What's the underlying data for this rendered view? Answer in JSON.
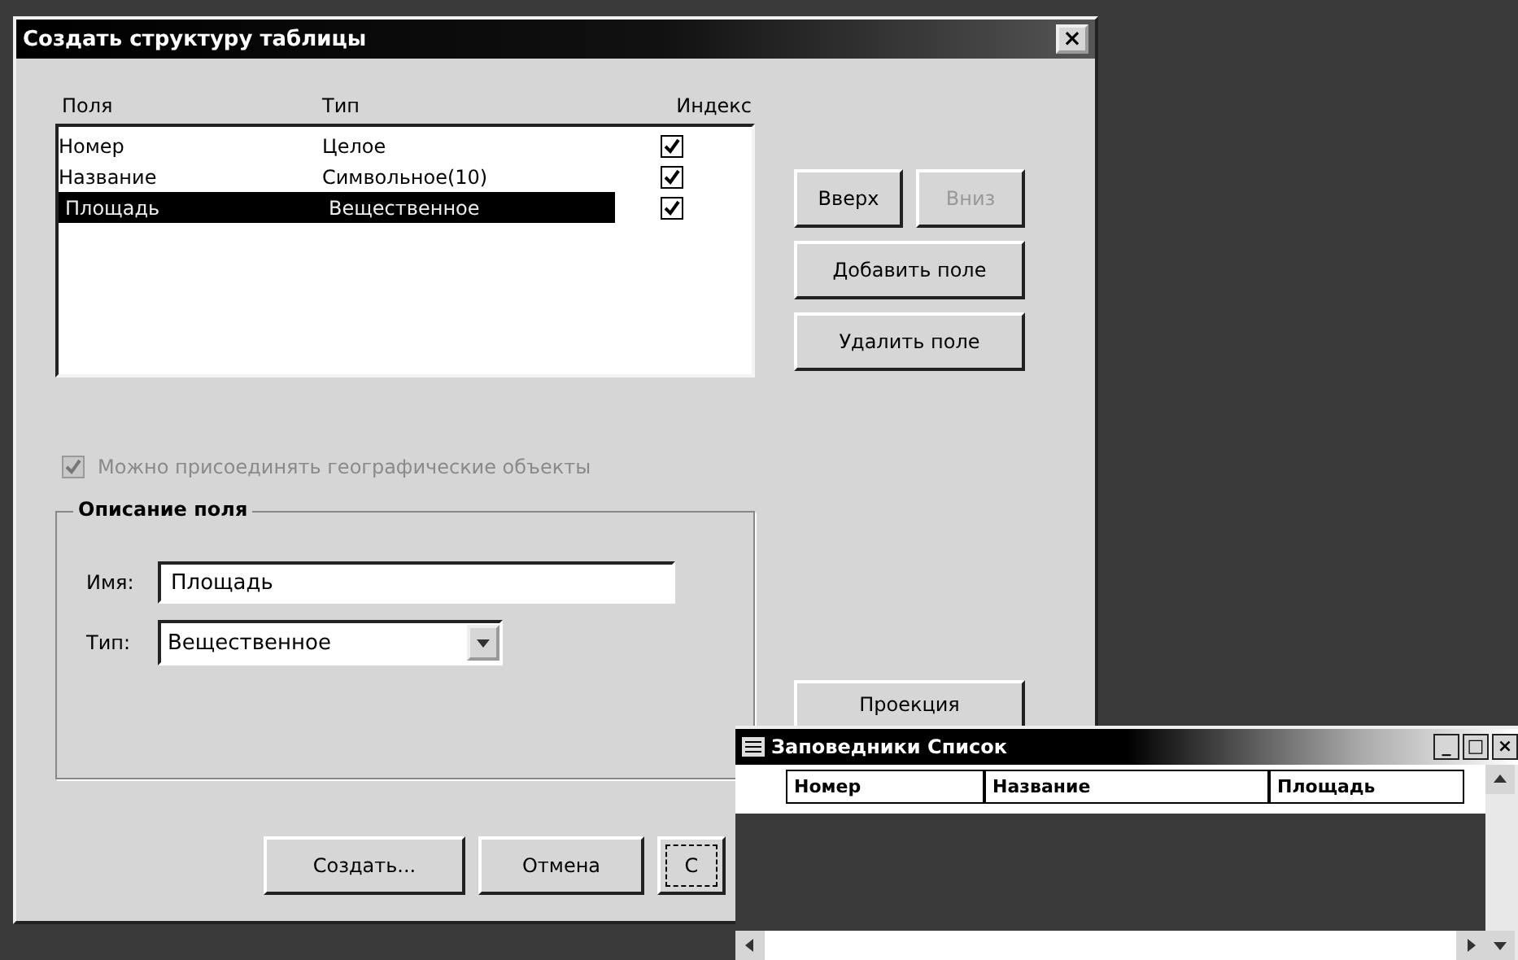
{
  "dialog": {
    "title": "Создать структуру таблицы",
    "close": "×",
    "columns": [
      "Поля",
      "Тип",
      "Индекс"
    ],
    "rows": [
      {
        "name": "Номер",
        "type": "Целое",
        "indexed": true,
        "selected": false
      },
      {
        "name": "Название",
        "type": "Символьное(10)",
        "indexed": true,
        "selected": false
      },
      {
        "name": "Площадь",
        "type": "Вещественное",
        "indexed": true,
        "selected": true
      }
    ],
    "side_buttons": [
      {
        "label": "Вверх",
        "disabled": false
      },
      {
        "label": "Вниз",
        "disabled": true
      },
      {
        "label": "Добавить поле",
        "disabled": false
      },
      {
        "label": "Удалить поле",
        "disabled": false
      }
    ],
    "geo_checkbox": {
      "label": "Можно присоединять географические объекты",
      "checked": true,
      "disabled": true
    },
    "field_group": {
      "title": "Описание поля",
      "name_label": "Имя:",
      "name_value": "Площадь",
      "type_label": "Тип:",
      "type_value": "Вещественное"
    },
    "projection_button": "Проекция",
    "bottom_buttons": [
      {
        "label": "Создать...",
        "focused": false
      },
      {
        "label": "Отмена",
        "focused": false
      },
      {
        "label": "С",
        "focused": true
      }
    ]
  },
  "list_window": {
    "title": "Заповедники Список",
    "controls": [
      "_",
      "□",
      "×"
    ],
    "columns": [
      "Номер",
      "Название",
      "Площадь"
    ]
  }
}
